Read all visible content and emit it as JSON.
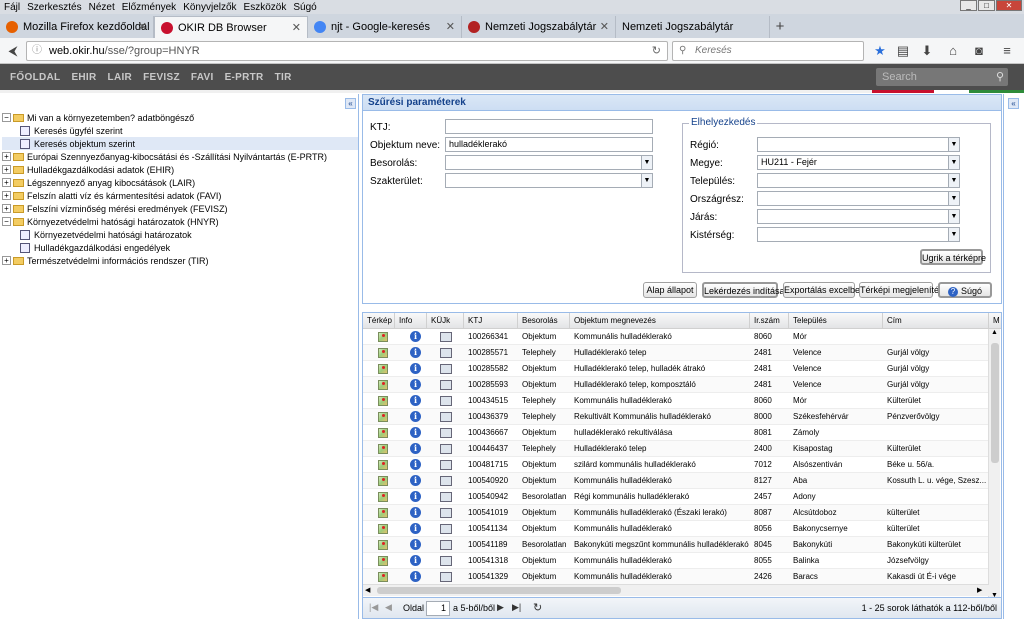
{
  "menubar": [
    "Fájl",
    "Szerkesztés",
    "Nézet",
    "Előzmények",
    "Könyvjelzők",
    "Eszközök",
    "Súgó"
  ],
  "window_controls": {
    "min": "_",
    "max": "□",
    "close": "✕"
  },
  "tabs": [
    {
      "label": "Mozilla Firefox kezdőoldal",
      "color": "#e66000",
      "active": false
    },
    {
      "label": "OKIR DB Browser",
      "color": "#c8102e",
      "active": true
    },
    {
      "label": "njt - Google-keresés",
      "color": "#4285f4",
      "active": false
    },
    {
      "label": "Nemzeti Jogszabálytár",
      "color": "#b22222",
      "active": false
    },
    {
      "label": "Nemzeti Jogszabálytár",
      "color": "",
      "active": false
    }
  ],
  "newtab": "+",
  "url": {
    "host": "web.okir.hu",
    "path": "/sse/?group=HNYR"
  },
  "browser_search_placeholder": "Keresés",
  "site_nav": [
    "FŐOLDAL",
    "EHIR",
    "LAIR",
    "FEVISZ",
    "FAVI",
    "E-PRTR",
    "TIR"
  ],
  "site_search_placeholder": "Search",
  "tree": [
    {
      "label": "Mi van a környezetemben? adatböngésző",
      "type": "folder",
      "expanded": true,
      "indent": 0
    },
    {
      "label": "Keresés ügyfél szerint",
      "type": "leaf",
      "indent": 1
    },
    {
      "label": "Keresés objektum szerint",
      "type": "leaf",
      "indent": 1,
      "selected": true
    },
    {
      "label": "Európai Szennyezőanyag-kibocsátási és -Szállítási Nyilvántartás (E-PRTR)",
      "type": "folder",
      "indent": 0
    },
    {
      "label": "Hulladékgazdálkodási adatok (EHIR)",
      "type": "folder",
      "indent": 0
    },
    {
      "label": "Légszennyező anyag kibocsátások (LAIR)",
      "type": "folder",
      "indent": 0
    },
    {
      "label": "Felszín alatti víz és kármentesítési adatok (FAVI)",
      "type": "folder",
      "indent": 0
    },
    {
      "label": "Felszíni vízminőség mérési eredmények (FEVISZ)",
      "type": "folder",
      "indent": 0
    },
    {
      "label": "Környezetvédelmi hatósági határozatok (HNYR)",
      "type": "folder",
      "expanded": true,
      "indent": 0
    },
    {
      "label": "Környezetvédelmi hatósági határozatok",
      "type": "leaf",
      "indent": 1
    },
    {
      "label": "Hulladékgazdálkodási engedélyek",
      "type": "leaf",
      "indent": 1
    },
    {
      "label": "Természetvédelmi információs rendszer (TIR)",
      "type": "folder",
      "indent": 0
    }
  ],
  "filter": {
    "title": "Szűrési paraméterek",
    "ktj_label": "KTJ:",
    "ktj_value": "",
    "obj_label": "Objektum neve:",
    "obj_value": "hulladéklerakó",
    "besorolas_label": "Besorolás:",
    "besorolas_value": "",
    "szakterulet_label": "Szakterület:",
    "szakterulet_value": "",
    "location_legend": "Elhelyezkedés",
    "regio_label": "Régió:",
    "regio_value": "",
    "megye_label": "Megye:",
    "megye_value": "HU211 - Fejér",
    "telepules_label": "Település:",
    "telepules_value": "",
    "orszagresz_label": "Országrész:",
    "orszagresz_value": "",
    "jaras_label": "Járás:",
    "jaras_value": "",
    "kisterseg_label": "Kistérség:",
    "kisterseg_value": "",
    "map_jump": "Ugrik a térképre",
    "btn_reset": "Alap állapot",
    "btn_query": "Lekérdezés indítása",
    "btn_export": "Exportálás excelbe",
    "btn_mapview": "Térképi megjelenítés",
    "btn_help": "Súgó"
  },
  "grid": {
    "headers": [
      "Térkép",
      "Info",
      "KÜJk",
      "KTJ",
      "Besorolás",
      "Objektum megnevezés",
      "Ir.szám",
      "Település",
      "Cím",
      "M"
    ],
    "rows": [
      [
        "100266341",
        "Objektum",
        "Kommunális hulladéklerakó",
        "8060",
        "Mór",
        ""
      ],
      [
        "100285571",
        "Telephely",
        "Hulladéklerakó telep",
        "2481",
        "Velence",
        "Gurjál völgy"
      ],
      [
        "100285582",
        "Objektum",
        "Hulladéklerakó telep, hulladék átrakó",
        "2481",
        "Velence",
        "Gurjál völgy"
      ],
      [
        "100285593",
        "Objektum",
        "Hulladéklerakó telep, komposztáló",
        "2481",
        "Velence",
        "Gurjál völgy"
      ],
      [
        "100434515",
        "Telephely",
        "Kommunális hulladéklerakó",
        "8060",
        "Mór",
        "Külterület"
      ],
      [
        "100436379",
        "Telephely",
        "Rekultivált Kommunális hulladéklerakó",
        "8000",
        "Székesfehérvár",
        "Pénzverővölgy"
      ],
      [
        "100436667",
        "Objektum",
        "hulladéklerakó rekultiválása",
        "8081",
        "Zámoly",
        ""
      ],
      [
        "100446437",
        "Telephely",
        "Hulladéklerakó telep",
        "2400",
        "Kisapostag",
        "Külterület"
      ],
      [
        "100481715",
        "Objektum",
        "szilárd kommunális hulladéklerakó",
        "7012",
        "Alsószentiván",
        "Béke u. 56/a."
      ],
      [
        "100540920",
        "Objektum",
        "Kommunális hulladéklerakó",
        "8127",
        "Aba",
        "Kossuth L. u. vége, Szesz..."
      ],
      [
        "100540942",
        "Besorolatlan",
        "Régi kommunális hulladéklerakó",
        "2457",
        "Adony",
        ""
      ],
      [
        "100541019",
        "Objektum",
        "Kommunális hulladéklerakó (Északi lerakó)",
        "8087",
        "Alcsútdoboz",
        "külterület"
      ],
      [
        "100541134",
        "Objektum",
        "Kommunális hulladéklerakó",
        "8056",
        "Bakonycsernye",
        "külterület"
      ],
      [
        "100541189",
        "Besorolatlan",
        "Bakonykúti megszűnt kommunális hulladéklerakó",
        "8045",
        "Bakonykúti",
        "Bakonykúti külterület"
      ],
      [
        "100541318",
        "Objektum",
        "Kommunális hulladéklerakó",
        "8055",
        "Balinka",
        "Józsefvölgy"
      ],
      [
        "100541329",
        "Objektum",
        "Kommunális hulladéklerakó",
        "2426",
        "Baracs",
        "Kakasdi út É-i vége"
      ]
    ]
  },
  "pager": {
    "page_label": "Oldal",
    "page_value": "1",
    "of_label": "a 5-ből/ből",
    "summary": "1 - 25 sorok láthatók a 112-ből/ből"
  }
}
